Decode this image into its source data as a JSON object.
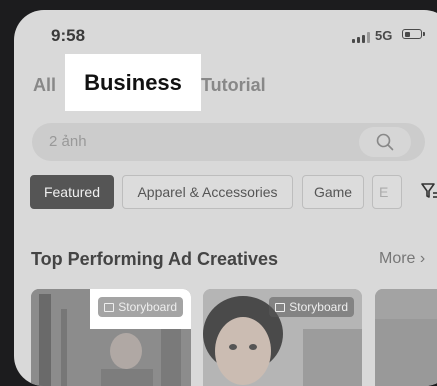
{
  "status_bar": {
    "time": "9:58",
    "network": "5G"
  },
  "tabs": [
    {
      "label": "All"
    },
    {
      "label": "Business"
    },
    {
      "label": "Tutorial"
    }
  ],
  "search": {
    "value": "2 ảnh"
  },
  "chips": [
    {
      "label": "Featured"
    },
    {
      "label": "Apparel & Accessories"
    },
    {
      "label": "Game"
    },
    {
      "label": "E"
    }
  ],
  "section": {
    "title": "Top Performing Ad Creatives",
    "more": "More"
  },
  "cards": [
    {
      "badge": "Storyboard"
    },
    {
      "badge": "Storyboard"
    }
  ]
}
